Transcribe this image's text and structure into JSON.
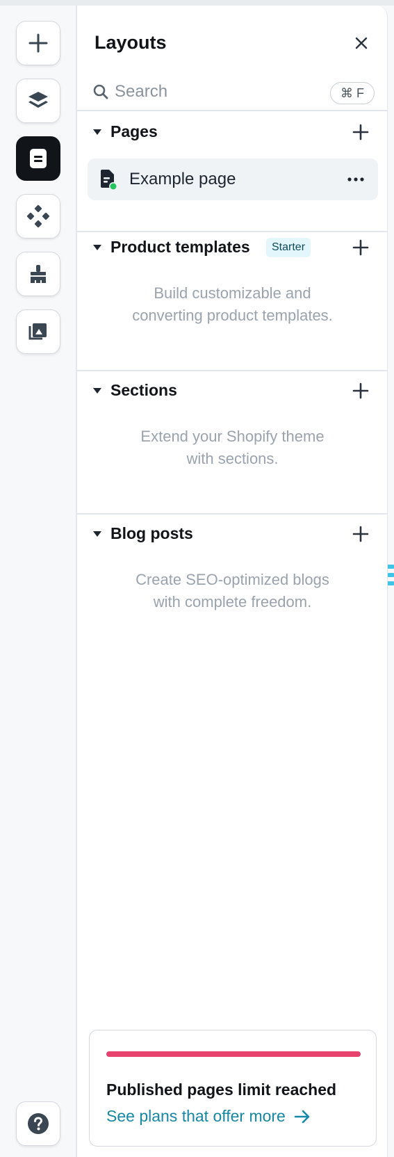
{
  "rail": {
    "buttons": [
      {
        "icon": "plus-icon",
        "active": false
      },
      {
        "icon": "layers-icon",
        "active": false
      },
      {
        "icon": "page-icon",
        "active": true
      },
      {
        "icon": "components-icon",
        "active": false
      },
      {
        "icon": "paintbrush-icon",
        "active": false
      },
      {
        "icon": "media-icon",
        "active": false
      }
    ],
    "help_icon": "help-circle-icon"
  },
  "panel": {
    "title": "Layouts",
    "search": {
      "placeholder": "Search",
      "value": "",
      "shortcut": "⌘ F"
    }
  },
  "sections": [
    {
      "title": "Pages",
      "items": [
        {
          "label": "Example page",
          "status_color": "#22c55e"
        }
      ]
    },
    {
      "title": "Product templates",
      "badge": "Starter",
      "empty_line1": "Build customizable and",
      "empty_line2": "converting product templates."
    },
    {
      "title": "Sections",
      "empty_line1": "Extend your Shopify theme",
      "empty_line2": "with sections."
    },
    {
      "title": "Blog posts",
      "empty_line1": "Create SEO-optimized blogs",
      "empty_line2": "with complete freedom."
    }
  ],
  "limit_card": {
    "title": "Published pages limit reached",
    "link": "See plans that offer more",
    "progress": 1.0
  },
  "colors": {
    "accent": "#1687a6",
    "warning_bar": "#e8426f",
    "active_rail": "#111418",
    "badge_bg": "#e2f6fb"
  }
}
